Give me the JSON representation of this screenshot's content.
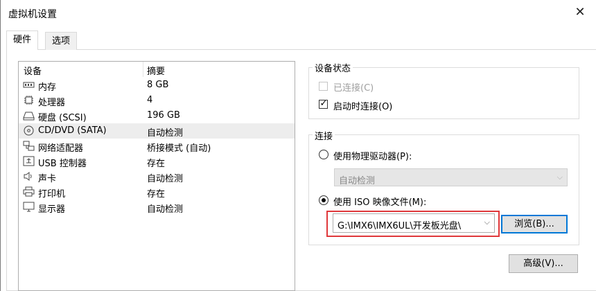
{
  "window": {
    "title": "虚拟机设置"
  },
  "tabs": [
    {
      "label": "硬件"
    },
    {
      "label": "选项"
    }
  ],
  "device_list": {
    "headers": {
      "device": "设备",
      "summary": "摘要"
    },
    "rows": [
      {
        "name": "内存",
        "summary": "8 GB",
        "icon": "memory-icon"
      },
      {
        "name": "处理器",
        "summary": "4",
        "icon": "cpu-icon"
      },
      {
        "name": "硬盘 (SCSI)",
        "summary": "196 GB",
        "icon": "hard-disk-icon"
      },
      {
        "name": "CD/DVD (SATA)",
        "summary": "自动检测",
        "icon": "cd-dvd-icon",
        "selected": true
      },
      {
        "name": "网络适配器",
        "summary": "桥接模式 (自动)",
        "icon": "network-adapter-icon"
      },
      {
        "name": "USB 控制器",
        "summary": "存在",
        "icon": "usb-icon"
      },
      {
        "name": "声卡",
        "summary": "自动检测",
        "icon": "speaker-icon"
      },
      {
        "name": "打印机",
        "summary": "存在",
        "icon": "printer-icon"
      },
      {
        "name": "显示器",
        "summary": "自动检测",
        "icon": "monitor-icon"
      }
    ]
  },
  "device_status": {
    "label": "设备状态",
    "connected": {
      "label": "已连接(C)",
      "checked": false,
      "disabled": true
    },
    "connect_on_power_on": {
      "label": "启动时连接(O)",
      "checked": true
    }
  },
  "connection": {
    "label": "连接",
    "physical_drive": {
      "label": "使用物理驱动器(P):",
      "selected": false,
      "value": "自动检测"
    },
    "iso_image": {
      "label": "使用 ISO 映像文件(M):",
      "selected": true,
      "value": "G:\\IMX6\\IMX6UL\\开发板光盘\\"
    },
    "browse_label": "浏览(B)..."
  },
  "advanced_label": "高级(V)...",
  "glyphs": {
    "check": "✓",
    "chevron": "⌵",
    "close": "✕"
  },
  "colors": {
    "highlight": "#e0383b",
    "focus": "#0078d7"
  }
}
